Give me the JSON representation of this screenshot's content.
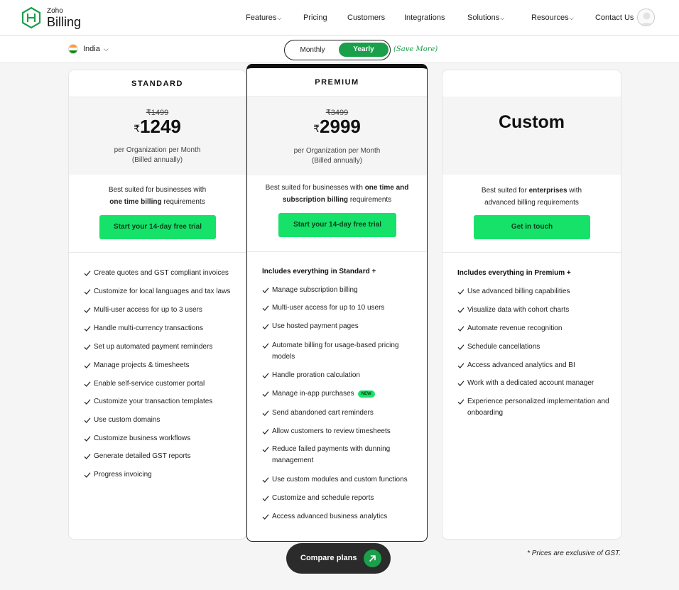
{
  "brand": {
    "small": "Zoho",
    "big": "Billing"
  },
  "nav": {
    "features": "Features",
    "pricing": "Pricing",
    "customers": "Customers",
    "integrations": "Integrations",
    "solutions": "Solutions",
    "resources": "Resources",
    "contact": "Contact Us"
  },
  "subbar": {
    "country": "India",
    "monthly": "Monthly",
    "yearly": "Yearly",
    "save_more": "(Save More)"
  },
  "plans": {
    "standard": {
      "name": "STANDARD",
      "old_price": "₹1499",
      "currency": "₹",
      "price": "1249",
      "per_line1": "per Organization per Month",
      "per_line2": "(Billed annually)",
      "suited_pre": "Best suited for businesses with",
      "suited_bold": "one time billing",
      "suited_post": " requirements",
      "cta": "Start your 14-day free trial",
      "features": [
        "Create quotes and GST compliant invoices",
        "Customize for local languages and tax laws",
        "Multi-user access for up to 3 users",
        "Handle multi-currency transactions",
        "Set up automated payment reminders",
        "Manage projects & timesheets",
        "Enable self-service customer portal",
        "Customize your transaction templates",
        "Use custom domains",
        "Customize business workflows",
        "Generate detailed GST reports",
        "Progress invoicing"
      ]
    },
    "premium": {
      "name": "PREMIUM",
      "old_price": "₹3499",
      "currency": "₹",
      "price": "2999",
      "per_line1": "per Organization per Month",
      "per_line2": "(Billed annually)",
      "suited_pre": "Best suited for businesses with ",
      "suited_bold1": "one time and",
      "suited_bold2": "subscription billing",
      "suited_post": " requirements",
      "cta": "Start your 14-day free trial",
      "features_head": "Includes everything in Standard +",
      "features": [
        "Manage subscription billing",
        "Multi-user access for up to 10 users",
        "Use hosted payment pages",
        "Automate billing for usage-based pricing models",
        "Handle proration calculation",
        "Manage in-app purchases",
        "Send abandoned cart reminders",
        "Allow customers to review timesheets",
        "Reduce failed payments with dunning management",
        "Use custom modules and custom functions",
        "Customize and schedule reports",
        "Access advanced business analytics"
      ],
      "new_badge": "NEW"
    },
    "custom": {
      "title": "Custom",
      "suited_pre": "Best suited for ",
      "suited_bold": "enterprises",
      "suited_post": " with",
      "suited_line2": "advanced billing requirements",
      "cta": "Get in touch",
      "features_head": "Includes everything in Premium +",
      "features": [
        "Use advanced billing capabilities",
        "Visualize data with cohort charts",
        "Automate revenue recognition",
        "Schedule cancellations",
        "Access advanced analytics and BI",
        "Work with a dedicated account manager",
        "Experience personalized implementation and onboarding"
      ]
    }
  },
  "compare_label": "Compare plans",
  "gst_note": "* Prices are exclusive of GST.",
  "colors": {
    "accent_green": "#16e26a",
    "toggle_green": "#1a9f4a",
    "dark": "#2b2b2b"
  }
}
